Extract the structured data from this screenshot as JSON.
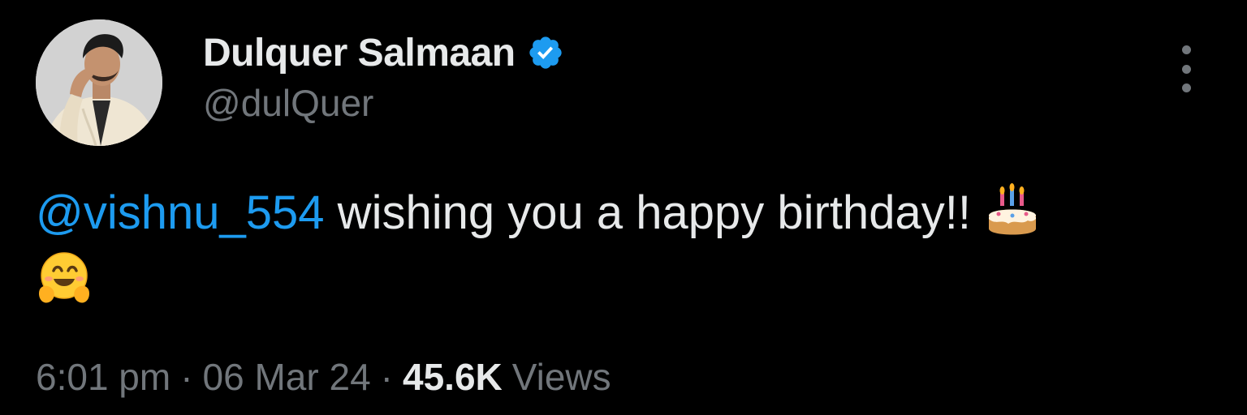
{
  "author": {
    "display_name": "Dulquer Salmaan",
    "handle": "@dulQuer",
    "verified": true,
    "avatar_icon": "profile-photo"
  },
  "tweet": {
    "mention": "@vishnu_554",
    "text": " wishing you a happy birthday!! ",
    "emojis": [
      "birthday-cake-emoji",
      "hugging-face-emoji"
    ]
  },
  "meta": {
    "time": "6:01 pm",
    "separator": "·",
    "date": "06 Mar 24",
    "views_count": "45.6K",
    "views_label": "Views"
  },
  "colors": {
    "background": "#000000",
    "text_primary": "#e7e9ea",
    "text_secondary": "#71767b",
    "accent": "#1d9bf0"
  },
  "icons": {
    "verified": "verified-badge-icon",
    "more": "more-options-icon"
  }
}
